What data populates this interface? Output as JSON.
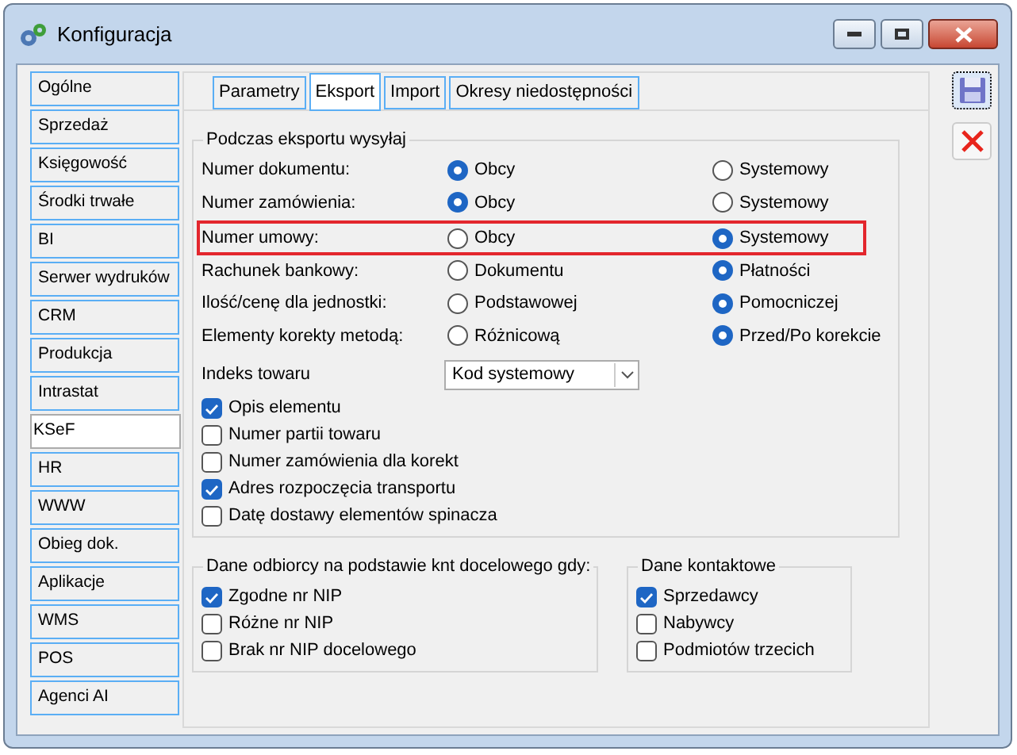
{
  "window": {
    "title": "Konfiguracja"
  },
  "sidebar": {
    "items": [
      {
        "label": "Ogólne",
        "selected": false
      },
      {
        "label": "Sprzedaż",
        "selected": false
      },
      {
        "label": "Księgowość",
        "selected": false
      },
      {
        "label": "Środki trwałe",
        "selected": false
      },
      {
        "label": "BI",
        "selected": false
      },
      {
        "label": "Serwer wydruków",
        "selected": false
      },
      {
        "label": "CRM",
        "selected": false
      },
      {
        "label": "Produkcja",
        "selected": false
      },
      {
        "label": "Intrastat",
        "selected": false
      },
      {
        "label": "KSeF",
        "selected": true
      },
      {
        "label": "HR",
        "selected": false
      },
      {
        "label": "WWW",
        "selected": false
      },
      {
        "label": "Obieg dok.",
        "selected": false
      },
      {
        "label": "Aplikacje",
        "selected": false
      },
      {
        "label": "WMS",
        "selected": false
      },
      {
        "label": "POS",
        "selected": false
      },
      {
        "label": "Agenci AI",
        "selected": false
      }
    ]
  },
  "tabs": [
    {
      "label": "Parametry",
      "selected": false
    },
    {
      "label": "Eksport",
      "selected": true
    },
    {
      "label": "Import",
      "selected": false
    },
    {
      "label": "Okresy niedostępności",
      "selected": false
    }
  ],
  "export_group": {
    "title": "Podczas eksportu wysyłaj",
    "rows": [
      {
        "label": "Numer dokumentu:",
        "highlighted": false,
        "options": [
          {
            "label": "Obcy",
            "selected": true
          },
          {
            "label": "Systemowy",
            "selected": false
          }
        ]
      },
      {
        "label": "Numer zamówienia:",
        "highlighted": false,
        "options": [
          {
            "label": "Obcy",
            "selected": true
          },
          {
            "label": "Systemowy",
            "selected": false
          }
        ]
      },
      {
        "label": "Numer umowy:",
        "highlighted": true,
        "options": [
          {
            "label": "Obcy",
            "selected": false
          },
          {
            "label": "Systemowy",
            "selected": true
          }
        ]
      },
      {
        "label": "Rachunek bankowy:",
        "highlighted": false,
        "options": [
          {
            "label": "Dokumentu",
            "selected": false
          },
          {
            "label": "Płatności",
            "selected": true
          }
        ]
      },
      {
        "label": "Ilość/cenę dla jednostki:",
        "highlighted": false,
        "options": [
          {
            "label": "Podstawowej",
            "selected": false
          },
          {
            "label": "Pomocniczej",
            "selected": true
          }
        ]
      },
      {
        "label": "Elementy korekty metodą:",
        "highlighted": false,
        "options": [
          {
            "label": "Różnicową",
            "selected": false
          },
          {
            "label": "Przed/Po korekcie",
            "selected": true
          }
        ]
      }
    ],
    "index": {
      "label": "Indeks towaru",
      "value": "Kod systemowy"
    },
    "checkboxes": [
      {
        "label": "Opis elementu",
        "checked": true
      },
      {
        "label": "Numer partii towaru",
        "checked": false
      },
      {
        "label": "Numer zamówienia dla korekt",
        "checked": false
      },
      {
        "label": "Adres rozpoczęcia transportu",
        "checked": true
      },
      {
        "label": "Datę dostawy elementów spinacza",
        "checked": false
      }
    ]
  },
  "recipient_group": {
    "title": "Dane odbiorcy na podstawie knt docelowego gdy:",
    "checkboxes": [
      {
        "label": "Zgodne nr NIP",
        "checked": true
      },
      {
        "label": "Różne nr NIP",
        "checked": false
      },
      {
        "label": "Brak nr NIP docelowego",
        "checked": false
      }
    ]
  },
  "contact_group": {
    "title": "Dane kontaktowe",
    "checkboxes": [
      {
        "label": "Sprzedawcy",
        "checked": true
      },
      {
        "label": "Nabywcy",
        "checked": false
      },
      {
        "label": "Podmiotów trzecich",
        "checked": false
      }
    ]
  }
}
